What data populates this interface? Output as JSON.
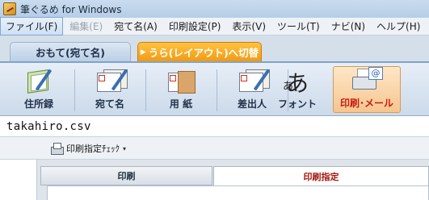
{
  "window": {
    "title": "筆ぐるめ for Windows"
  },
  "menu": [
    {
      "label": "ファイル(F)",
      "state": "active"
    },
    {
      "label": "編集(E)",
      "state": "disabled"
    },
    {
      "label": "宛て名(A)",
      "state": "normal"
    },
    {
      "label": "印刷設定(P)",
      "state": "normal"
    },
    {
      "label": "表示(V)",
      "state": "normal"
    },
    {
      "label": "ツール(T)",
      "state": "normal"
    },
    {
      "label": "ナビ(N)",
      "state": "normal"
    },
    {
      "label": "ヘルプ(H)",
      "state": "normal"
    }
  ],
  "mode_tabs": {
    "front": "おもて(宛て名)",
    "back": "うら(レイアウト)へ切替"
  },
  "toolbar": [
    {
      "label": "住所録",
      "icon": "address-book-icon"
    },
    {
      "label": "宛て名",
      "icon": "address-card-icon"
    },
    {
      "label": "用 紙",
      "icon": "paper-icon"
    },
    {
      "label": "差出人",
      "icon": "sender-icon"
    },
    {
      "label": "フォント",
      "icon": "font-icon",
      "glyph_large": "あ",
      "glyph_small": "あ"
    },
    {
      "label": "印刷･メール",
      "icon": "print-mail-icon",
      "selected": true,
      "mail_glyph": "@"
    }
  ],
  "file": {
    "name": "takahiro.csv"
  },
  "subtoolbar": {
    "print_check_label": "印刷指定ﾁｪｯｸ",
    "caret": "▾"
  },
  "content_tabs": {
    "print": "印刷",
    "print_spec": "印刷指定"
  },
  "colors": {
    "accent_orange": "#f29a13",
    "selected_label_red": "#c61d10",
    "tab_red_text": "#a3140b"
  }
}
